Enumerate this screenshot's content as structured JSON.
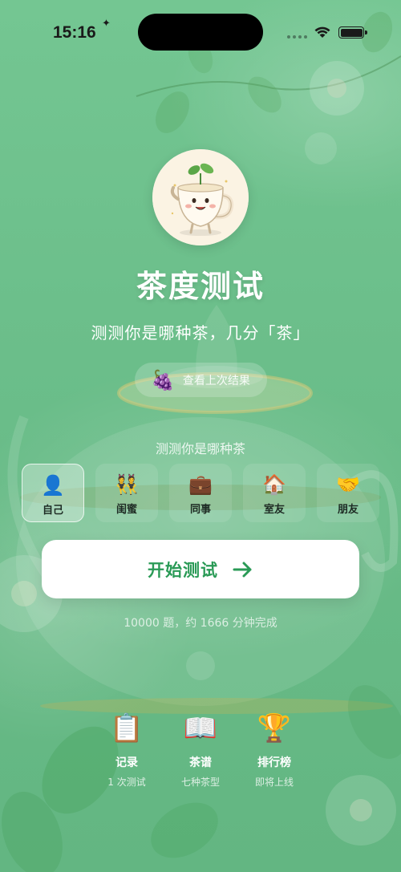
{
  "status_bar": {
    "time": "15:16",
    "icons": [
      "cellular-icon",
      "wifi-icon",
      "battery-icon"
    ]
  },
  "app": {
    "title": "茶度测试",
    "subtitle": "测测你是哪种茶，几分「茶」",
    "logo_icon": "teacup-mascot-icon"
  },
  "last_result": {
    "label": "查看上次结果",
    "icon": "grape-icon"
  },
  "target_section": {
    "label": "测测你是哪种茶",
    "items": [
      {
        "label": "自己",
        "icon": "person-icon",
        "selected": true
      },
      {
        "label": "闺蜜",
        "icon": "besties-icon",
        "selected": false
      },
      {
        "label": "同事",
        "icon": "briefcase-icon",
        "selected": false
      },
      {
        "label": "室友",
        "icon": "house-icon",
        "selected": false
      },
      {
        "label": "朋友",
        "icon": "handshake-icon",
        "selected": false
      }
    ]
  },
  "start": {
    "label": "开始测试",
    "icon": "arrow-right-icon"
  },
  "hint": "10000 题，约 1666 分钟完成",
  "bottom_nav": [
    {
      "title": "记录",
      "subtitle": "1 次测试",
      "icon": "clipboard-icon"
    },
    {
      "title": "茶谱",
      "subtitle": "七种茶型",
      "icon": "open-book-icon"
    },
    {
      "title": "排行榜",
      "subtitle": "即将上线",
      "icon": "trophy-icon"
    }
  ],
  "colors": {
    "accent": "#2a9a56",
    "background": "#6cbf8b",
    "text_on_bg": "#ffffff"
  }
}
